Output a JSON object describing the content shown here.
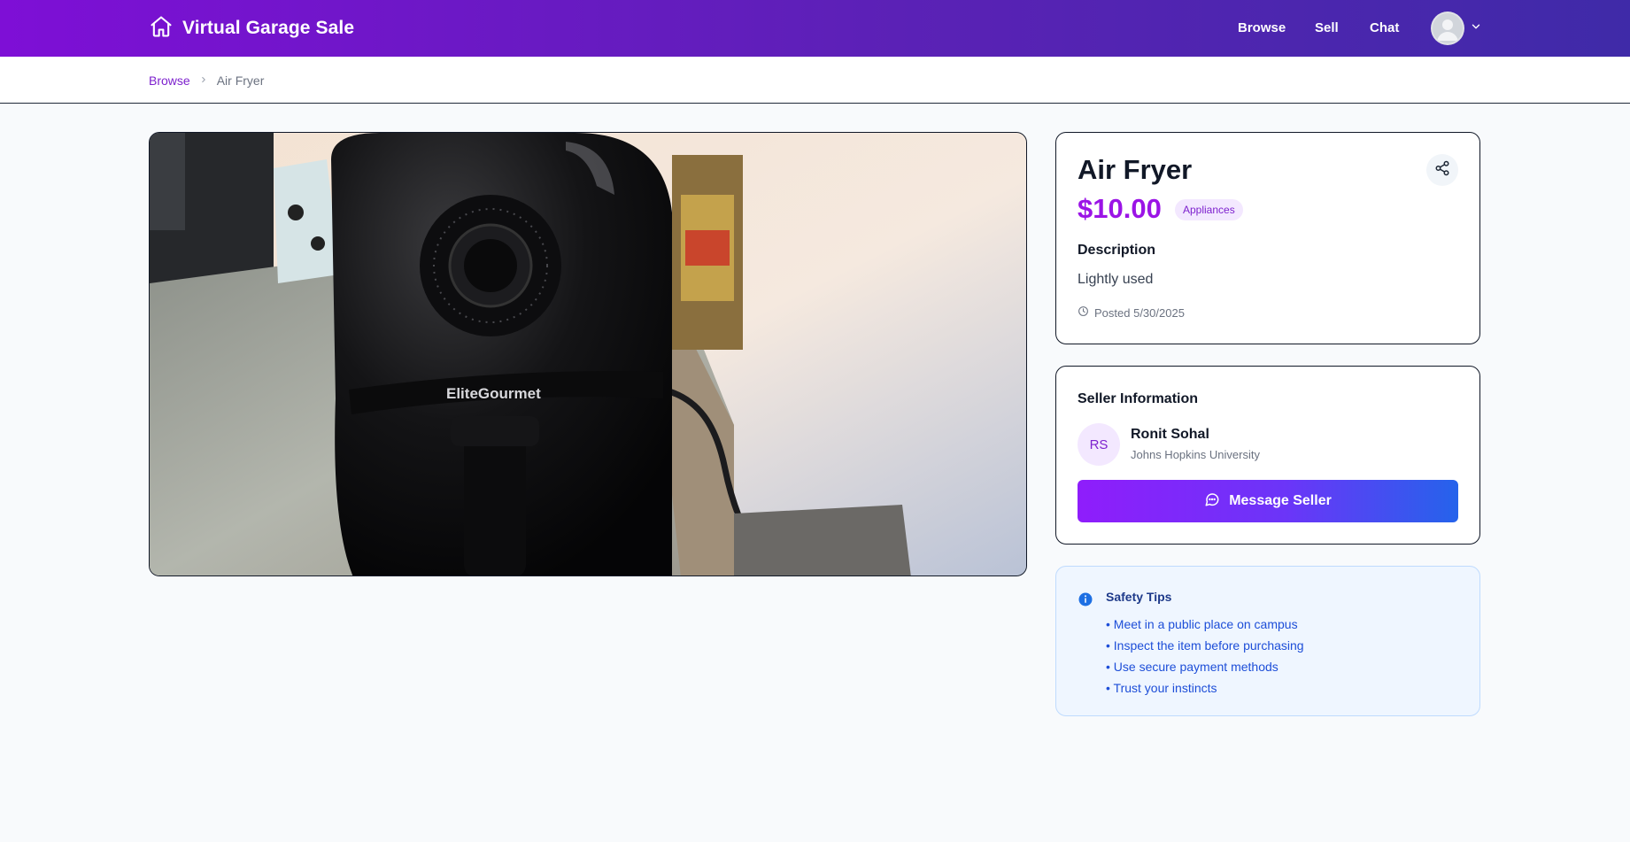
{
  "header": {
    "brand": "Virtual Garage Sale",
    "nav": [
      {
        "label": "Browse"
      },
      {
        "label": "Sell"
      },
      {
        "label": "Chat"
      }
    ],
    "icons": {
      "brand": "home-icon",
      "avatar": "user-avatar",
      "menu": "chevron-down-icon"
    }
  },
  "breadcrumb": {
    "parent": "Browse",
    "current": "Air Fryer"
  },
  "listing": {
    "title": "Air Fryer",
    "price": "$10.00",
    "category": "Appliances",
    "description_heading": "Description",
    "description": "Lightly used",
    "posted": "Posted 5/30/2025",
    "photo_brand_text": "EliteGourmet"
  },
  "seller": {
    "heading": "Seller Information",
    "initials": "RS",
    "name": "Ronit Sohal",
    "school": "Johns Hopkins University",
    "message_label": "Message Seller"
  },
  "safety": {
    "title": "Safety Tips",
    "tips": [
      "• Meet in a public place on campus",
      "• Inspect the item before purchasing",
      "• Use secure payment methods",
      "• Trust your instincts"
    ]
  },
  "colors": {
    "brand_purple": "#7e0fd6",
    "price": "#9b14e6",
    "button_start": "#8f1dfb",
    "button_end": "#2563eb"
  }
}
